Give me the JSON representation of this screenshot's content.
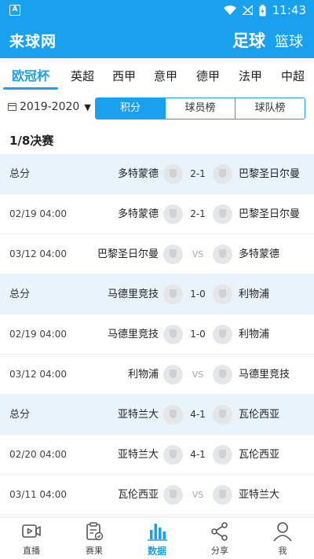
{
  "status_bar": {
    "time": "11:43",
    "left_icon": "app-notification-icon"
  },
  "app_bar": {
    "brand": "来球网",
    "sport_tabs": [
      {
        "label": "足球",
        "active": true
      },
      {
        "label": "篮球",
        "active": false
      }
    ]
  },
  "league_tabs": [
    {
      "label": "欧冠杯",
      "active": true
    },
    {
      "label": "英超",
      "active": false
    },
    {
      "label": "西甲",
      "active": false
    },
    {
      "label": "意甲",
      "active": false
    },
    {
      "label": "德甲",
      "active": false
    },
    {
      "label": "法甲",
      "active": false
    },
    {
      "label": "中超",
      "active": false
    }
  ],
  "filter": {
    "season": "2019-2020",
    "segments": [
      {
        "label": "积分",
        "active": true
      },
      {
        "label": "球员榜",
        "active": false
      },
      {
        "label": "球队榜",
        "active": false
      }
    ]
  },
  "stage_title": "1/8决赛",
  "matches": [
    {
      "label": "总分",
      "home": "多特蒙德",
      "score": "2-1",
      "away": "巴黎圣日尔曼",
      "total": true
    },
    {
      "label": "02/19 04:00",
      "home": "多特蒙德",
      "score": "2-1",
      "away": "巴黎圣日尔曼",
      "total": false
    },
    {
      "label": "03/12 04:00",
      "home": "巴黎圣日尔曼",
      "score": "VS",
      "away": "多特蒙德",
      "total": false
    },
    {
      "label": "总分",
      "home": "马德里竞技",
      "score": "1-0",
      "away": "利物浦",
      "total": true
    },
    {
      "label": "02/19 04:00",
      "home": "马德里竞技",
      "score": "1-0",
      "away": "利物浦",
      "total": false
    },
    {
      "label": "03/12 04:00",
      "home": "利物浦",
      "score": "VS",
      "away": "马德里竞技",
      "total": false
    },
    {
      "label": "总分",
      "home": "亚特兰大",
      "score": "4-1",
      "away": "瓦伦西亚",
      "total": true
    },
    {
      "label": "02/20 04:00",
      "home": "亚特兰大",
      "score": "4-1",
      "away": "瓦伦西亚",
      "total": false
    },
    {
      "label": "03/11 04:00",
      "home": "瓦伦西亚",
      "score": "VS",
      "away": "亚特兰大",
      "total": false
    }
  ],
  "bottom_nav": [
    {
      "label": "直播",
      "icon": "live-video-icon",
      "active": false
    },
    {
      "label": "赛果",
      "icon": "results-clipboard-icon",
      "active": false
    },
    {
      "label": "数据",
      "icon": "data-bar-chart-icon",
      "active": true
    },
    {
      "label": "分享",
      "icon": "share-icon",
      "active": false
    },
    {
      "label": "我",
      "icon": "profile-icon",
      "active": false
    }
  ],
  "colors": {
    "accent": "#1aa1ee",
    "total_row_bg": "#e8f3fb"
  }
}
